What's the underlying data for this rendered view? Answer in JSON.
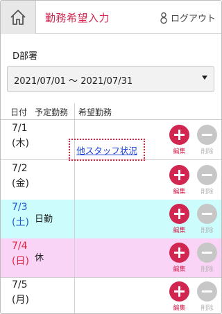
{
  "header": {
    "title": "勤務希望入力",
    "logout_label": "ログアウト",
    "accent_color": "#d0264f"
  },
  "department": "D部署",
  "period_select": {
    "value": "2021/07/01 ～ 2021/07/31"
  },
  "table": {
    "columns": [
      "日付",
      "予定勤務",
      "希望勤務"
    ],
    "rows": [
      {
        "date": "7/1",
        "dow": "(木)",
        "shift": "",
        "day_type": "weekday"
      },
      {
        "date": "7/2",
        "dow": "(金)",
        "shift": "",
        "day_type": "weekday"
      },
      {
        "date": "7/3",
        "dow": "(土)",
        "shift": "日勤",
        "day_type": "saturday"
      },
      {
        "date": "7/4",
        "dow": "(日)",
        "shift": "休",
        "day_type": "sunday"
      },
      {
        "date": "7/5",
        "dow": "(月)",
        "shift": "",
        "day_type": "weekday"
      }
    ],
    "edit_label": "編集",
    "delete_label": "削除",
    "other_staff_link": "他スタッフ状況"
  },
  "icons": [
    "home-icon",
    "key-icon",
    "plus-circle-icon",
    "minus-circle-icon",
    "dropdown-arrow-icon"
  ]
}
